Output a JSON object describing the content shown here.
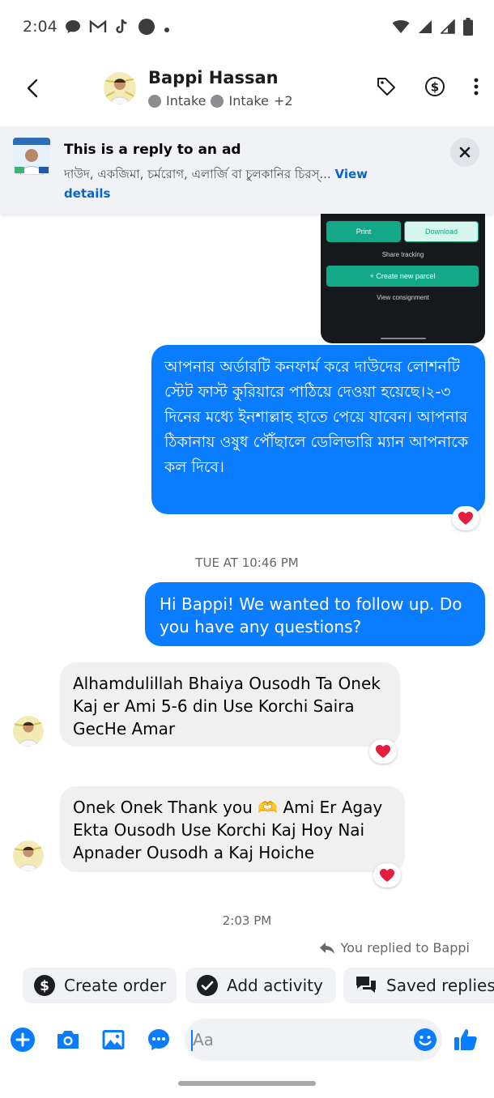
{
  "status_bar": {
    "time": "2:04"
  },
  "header": {
    "contact_name": "Bappi Hassan",
    "tag_1": "Intake",
    "tag_2": "Intake",
    "tag_more": "+2"
  },
  "ad_banner": {
    "title": "This is a reply to an ad",
    "description": "দাউদ, একজিমা, চর্মরোগ, এলার্জি বা চুলকানির চিরস্...",
    "link_word_1": "View",
    "link_word_2": "details"
  },
  "shared_screenshot": {
    "print_label": "Print",
    "download_label": "Download",
    "share_label": "Share tracking",
    "create_label": "+ Create new parcel",
    "view_label": "View consignment"
  },
  "messages": [
    {
      "direction": "outgoing",
      "text": "আপনার অর্ডারটি কনফার্ম করে দাউদের লোশনটি স্টেট ফাস্ট কুরিয়ারে পাঠিয়ে দেওয়া হয়েছে।২-৩ দিনের মধ্যে ইনশাল্লাহ হাতে পেয়ে যাবেন। আপনার ঠিকানায় ওষুধ পৌঁছালে ডেলিভারি ম্যান আপনাকে কল দিবে।",
      "reaction": "heart"
    },
    {
      "direction": "outgoing",
      "text": "Hi Bappi! We wanted to follow up. Do you have any questions?"
    },
    {
      "direction": "incoming",
      "text": "Alhamdulillah Bhaiya Ousodh Ta Onek Kaj er Ami 5-6 din Use Korchi Saira GecHe Amar",
      "reaction": "heart"
    },
    {
      "direction": "incoming",
      "text": "Onek Onek Thank you 🫶 Ami Er Agay Ekta Ousodh Use Korchi Kaj Hoy Nai Apnader Ousodh a Kaj Hoiche",
      "reaction": "heart"
    }
  ],
  "timestamps": {
    "t1": "TUE AT 10:46 PM",
    "t2": "2:03 PM"
  },
  "replied_note": "You replied to Bappi",
  "quick_actions": [
    {
      "label": "Create order",
      "icon": "dollar-circle-icon"
    },
    {
      "label": "Add activity",
      "icon": "check-circle-icon"
    },
    {
      "label": "Saved replies",
      "icon": "chat-bubbles-icon"
    }
  ],
  "composer": {
    "placeholder": "Aa"
  },
  "colors": {
    "accent": "#0a7cff",
    "heart": "#e41e3f",
    "incoming_bubble": "#f0f0f0"
  }
}
